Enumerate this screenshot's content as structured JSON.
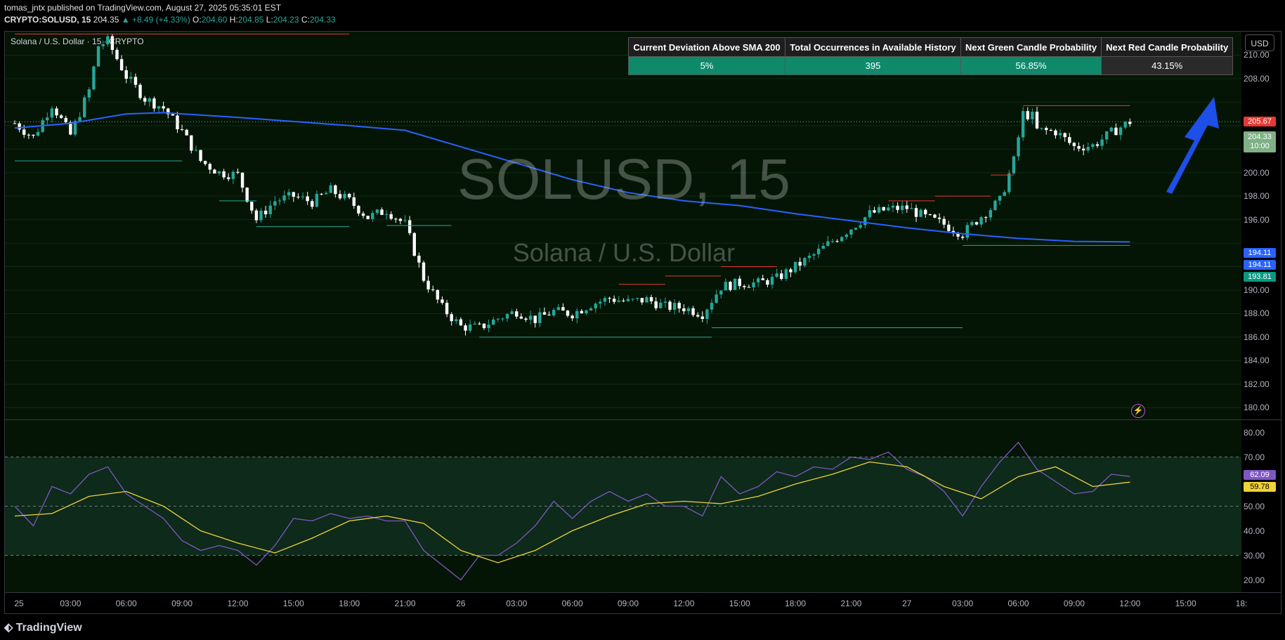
{
  "header": {
    "line1": "tomas_jntx published on TradingView.com, August 27, 2025 05:35:01 EST",
    "symbol": "CRYPTO:SOLUSD, 15",
    "price": "204.35",
    "change": "▲ +8.49 (+4.33%)",
    "o_label": "O:",
    "o": "204.60",
    "h_label": "H:",
    "h": "204.85",
    "l_label": "L:",
    "l": "204.23",
    "c_label": "C:",
    "c": "204.33"
  },
  "symbol_label": "Solana / U.S. Dollar · 15 · CRYPTO",
  "watermark": {
    "ticker": "SOLUSD, 15",
    "name": "Solana / U.S. Dollar"
  },
  "currency_button": "USD",
  "stats_table": {
    "headers": [
      "Current Deviation Above SMA 200",
      "Total Occurrences in Available History",
      "Next Green Candle Probability",
      "Next Red Candle Probability"
    ],
    "values": [
      "5%",
      "395",
      "56.85%",
      "43.15%"
    ]
  },
  "price_axis_ticks": [
    "210.00",
    "208.00",
    "202.00",
    "200.00",
    "198.00",
    "196.00",
    "190.00",
    "188.00",
    "186.00",
    "184.00",
    "182.00",
    "180.00"
  ],
  "price_tags": {
    "high": "205.67",
    "last": "204.33",
    "countdown": "10:00",
    "sma_a": "194.11",
    "sma_b": "194.11",
    "support": "193.81"
  },
  "rsi_axis_ticks": [
    "80.00",
    "70.00",
    "50.00",
    "40.00",
    "30.00",
    "20.00"
  ],
  "rsi_tags": {
    "rsi": "62.09",
    "ma": "59.78"
  },
  "time_ticks": [
    "25",
    "03:00",
    "06:00",
    "09:00",
    "12:00",
    "15:00",
    "18:00",
    "21:00",
    "26",
    "03:00",
    "06:00",
    "09:00",
    "12:00",
    "15:00",
    "18:00",
    "21:00",
    "27",
    "03:00",
    "06:00",
    "09:00",
    "12:00",
    "15:00",
    "18:"
  ],
  "footer_brand": "TradingView",
  "colors": {
    "up": "#26a69a",
    "down": "#ffffff",
    "sma": "#2962ff",
    "rsi": "#7e57c2",
    "rsi_ma": "#f0d23a",
    "arrow": "#1e4fe8"
  },
  "chart_data": [
    {
      "type": "candlestick",
      "title": "SOLUSD, 15",
      "ylim": [
        179,
        212
      ],
      "x_range": [
        "25 00:00",
        "27 18:00"
      ],
      "close_path": [
        [
          "25 00:00",
          204.2
        ],
        [
          "25 01:00",
          203.0
        ],
        [
          "25 02:00",
          205.8
        ],
        [
          "25 03:00",
          203.2
        ],
        [
          "25 04:00",
          207.0
        ],
        [
          "25 04:30",
          210.8
        ],
        [
          "25 05:00",
          211.2
        ],
        [
          "25 06:00",
          208.2
        ],
        [
          "25 07:00",
          206.3
        ],
        [
          "25 08:00",
          205.5
        ],
        [
          "25 09:00",
          203.5
        ],
        [
          "25 10:00",
          201.0
        ],
        [
          "25 11:00",
          200.0
        ],
        [
          "25 12:00",
          199.8
        ],
        [
          "25 13:00",
          196.0
        ],
        [
          "25 14:00",
          197.6
        ],
        [
          "25 15:00",
          198.0
        ],
        [
          "25 16:00",
          197.5
        ],
        [
          "25 17:00",
          198.5
        ],
        [
          "25 18:00",
          197.6
        ],
        [
          "25 19:00",
          196.2
        ],
        [
          "25 20:00",
          196.8
        ],
        [
          "25 21:00",
          195.6
        ],
        [
          "25 22:00",
          191.0
        ],
        [
          "25 23:00",
          188.5
        ],
        [
          "26 00:00",
          186.9
        ],
        [
          "26 01:00",
          186.8
        ],
        [
          "26 02:00",
          187.6
        ],
        [
          "26 03:00",
          188.2
        ],
        [
          "26 04:00",
          187.5
        ],
        [
          "26 05:00",
          188.2
        ],
        [
          "26 06:00",
          188.0
        ],
        [
          "26 07:00",
          188.8
        ],
        [
          "26 08:00",
          189.3
        ],
        [
          "26 09:00",
          189.0
        ],
        [
          "26 10:00",
          189.2
        ],
        [
          "26 11:00",
          188.6
        ],
        [
          "26 12:00",
          188.5
        ],
        [
          "26 13:00",
          188.0
        ],
        [
          "26 14:00",
          190.3
        ],
        [
          "26 15:00",
          190.6
        ],
        [
          "26 16:00",
          190.6
        ],
        [
          "26 17:00",
          191.0
        ],
        [
          "26 18:00",
          192.0
        ],
        [
          "26 19:00",
          193.0
        ],
        [
          "26 20:00",
          194.2
        ],
        [
          "26 21:00",
          195.3
        ],
        [
          "26 22:00",
          196.5
        ],
        [
          "26 23:00",
          196.9
        ],
        [
          "27 00:00",
          197.0
        ],
        [
          "27 01:00",
          196.2
        ],
        [
          "27 02:00",
          195.6
        ],
        [
          "27 03:00",
          194.8
        ],
        [
          "27 04:00",
          196.3
        ],
        [
          "27 05:00",
          197.6
        ],
        [
          "27 05:45",
          201.0
        ],
        [
          "27 06:15",
          205.0
        ],
        [
          "27 06:45",
          204.8
        ],
        [
          "27 07:00",
          203.6
        ],
        [
          "27 08:00",
          203.5
        ],
        [
          "27 09:00",
          202.2
        ],
        [
          "27 10:00",
          202.3
        ],
        [
          "27 11:00",
          203.4
        ],
        [
          "27 12:00",
          204.33
        ]
      ]
    },
    {
      "type": "line",
      "series": [
        {
          "name": "",
          "values": [
            [
              "25 00:00",
              203.8
            ],
            [
              "25 03:00",
              204.2
            ],
            [
              "25 06:00",
              205.0
            ],
            [
              "25 08:00",
              205.1
            ],
            [
              "25 12:00",
              204.7
            ],
            [
              "25 18:00",
              204.0
            ],
            [
              "25 21:00",
              203.6
            ],
            [
              "26 00:00",
              202.2
            ],
            [
              "26 03:00",
              200.8
            ],
            [
              "26 06:00",
              199.4
            ],
            [
              "26 09:00",
              198.3
            ],
            [
              "26 12:00",
              197.6
            ],
            [
              "26 15:00",
              197.2
            ],
            [
              "26 18:00",
              196.5
            ],
            [
              "26 21:00",
              195.9
            ],
            [
              "27 00:00",
              195.3
            ],
            [
              "27 03:00",
              194.8
            ],
            [
              "27 06:00",
              194.4
            ],
            [
              "27 09:00",
              194.15
            ],
            [
              "27 12:00",
              194.11
            ]
          ]
        }
      ]
    },
    {
      "type": "line",
      "ylim": [
        15,
        85
      ],
      "series": [
        {
          "name": "",
          "values": [
            [
              "25 00:00",
              50
            ],
            [
              "25 01:00",
              42
            ],
            [
              "25 02:00",
              58
            ],
            [
              "25 03:00",
              55
            ],
            [
              "25 04:00",
              63
            ],
            [
              "25 05:00",
              66
            ],
            [
              "25 06:00",
              55
            ],
            [
              "25 07:00",
              50
            ],
            [
              "25 08:00",
              45
            ],
            [
              "25 09:00",
              36
            ],
            [
              "25 10:00",
              32
            ],
            [
              "25 11:00",
              34
            ],
            [
              "25 12:00",
              32
            ],
            [
              "25 13:00",
              26
            ],
            [
              "25 14:00",
              34
            ],
            [
              "25 15:00",
              45
            ],
            [
              "25 16:00",
              44
            ],
            [
              "25 17:00",
              47
            ],
            [
              "25 18:00",
              45
            ],
            [
              "25 19:00",
              46
            ],
            [
              "25 20:00",
              44
            ],
            [
              "25 21:00",
              44
            ],
            [
              "25 22:00",
              32
            ],
            [
              "25 23:00",
              26
            ],
            [
              "26 00:00",
              20
            ],
            [
              "26 01:00",
              30
            ],
            [
              "26 02:00",
              30
            ],
            [
              "26 03:00",
              35
            ],
            [
              "26 04:00",
              42
            ],
            [
              "26 05:00",
              52
            ],
            [
              "26 06:00",
              45
            ],
            [
              "26 07:00",
              52
            ],
            [
              "26 08:00",
              56
            ],
            [
              "26 09:00",
              52
            ],
            [
              "26 10:00",
              55
            ],
            [
              "26 11:00",
              50
            ],
            [
              "26 12:00",
              50
            ],
            [
              "26 13:00",
              46
            ],
            [
              "26 14:00",
              62
            ],
            [
              "26 15:00",
              55
            ],
            [
              "26 16:00",
              58
            ],
            [
              "26 17:00",
              64
            ],
            [
              "26 18:00",
              62
            ],
            [
              "26 19:00",
              66
            ],
            [
              "26 20:00",
              65
            ],
            [
              "26 21:00",
              70
            ],
            [
              "26 22:00",
              69
            ],
            [
              "26 23:00",
              72
            ],
            [
              "27 00:00",
              65
            ],
            [
              "27 01:00",
              62
            ],
            [
              "27 02:00",
              56
            ],
            [
              "27 03:00",
              46
            ],
            [
              "27 04:00",
              58
            ],
            [
              "27 05:00",
              68
            ],
            [
              "27 06:00",
              76
            ],
            [
              "27 07:00",
              65
            ],
            [
              "27 08:00",
              60
            ],
            [
              "27 09:00",
              55
            ],
            [
              "27 10:00",
              56
            ],
            [
              "27 11:00",
              63
            ],
            [
              "27 12:00",
              62.09
            ]
          ]
        },
        {
          "name": "",
          "values": [
            [
              "25 00:00",
              46
            ],
            [
              "25 02:00",
              47
            ],
            [
              "25 04:00",
              54
            ],
            [
              "25 06:00",
              56
            ],
            [
              "25 08:00",
              50
            ],
            [
              "25 10:00",
              40
            ],
            [
              "25 12:00",
              35
            ],
            [
              "25 14:00",
              31
            ],
            [
              "25 16:00",
              37
            ],
            [
              "25 18:00",
              44
            ],
            [
              "25 20:00",
              46
            ],
            [
              "25 22:00",
              43
            ],
            [
              "26 00:00",
              32
            ],
            [
              "26 02:00",
              27
            ],
            [
              "26 04:00",
              32
            ],
            [
              "26 06:00",
              40
            ],
            [
              "26 08:00",
              46
            ],
            [
              "26 10:00",
              51
            ],
            [
              "26 12:00",
              52
            ],
            [
              "26 14:00",
              51
            ],
            [
              "26 16:00",
              54
            ],
            [
              "26 18:00",
              59
            ],
            [
              "26 20:00",
              63
            ],
            [
              "26 22:00",
              68
            ],
            [
              "27 00:00",
              66
            ],
            [
              "27 02:00",
              58
            ],
            [
              "27 04:00",
              53
            ],
            [
              "27 06:00",
              62
            ],
            [
              "27 08:00",
              66
            ],
            [
              "27 10:00",
              58
            ],
            [
              "27 12:00",
              59.78
            ]
          ]
        }
      ]
    }
  ]
}
